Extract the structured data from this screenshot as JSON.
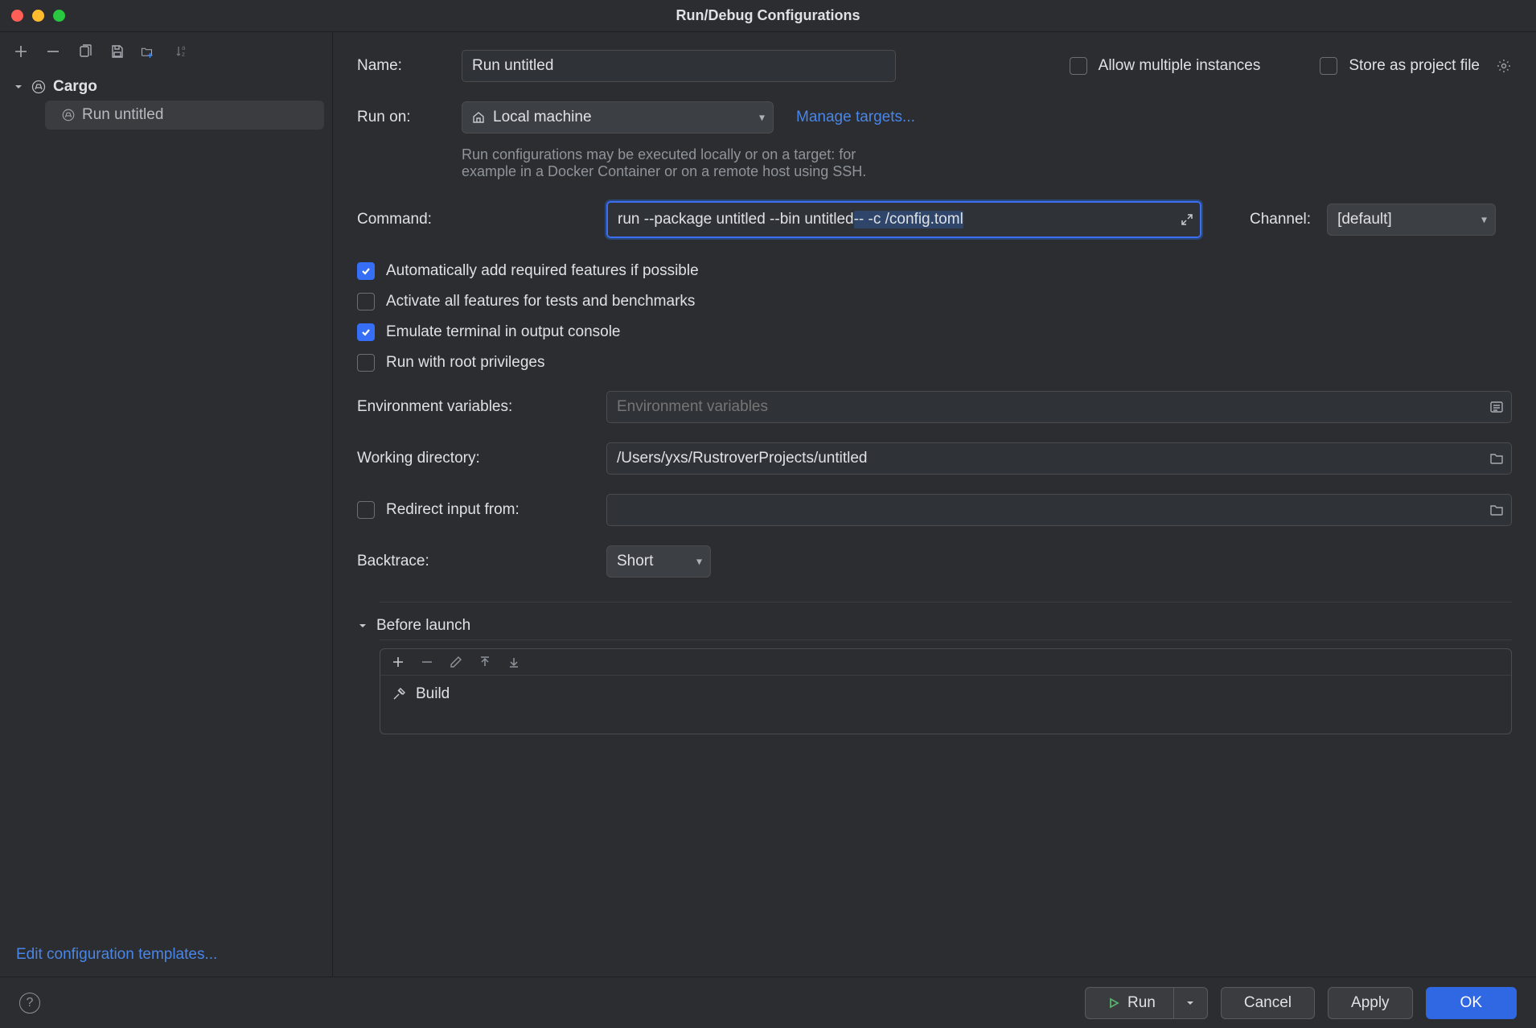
{
  "window": {
    "title": "Run/Debug Configurations"
  },
  "sidebar": {
    "group": "Cargo",
    "item": "Run untitled",
    "footer_link": "Edit configuration templates..."
  },
  "fields": {
    "name_label": "Name:",
    "name_value": "Run untitled",
    "allow_multiple": "Allow multiple instances",
    "store_project": "Store as project file",
    "run_on_label": "Run on:",
    "run_on_value": "Local machine",
    "manage_targets": "Manage targets...",
    "run_on_help1": "Run configurations may be executed locally or on a target: for",
    "run_on_help2": "example in a Docker Container or on a remote host using SSH.",
    "command_label": "Command:",
    "command_value_pre": "run --package untitled --bin untitled",
    "command_value_sel": " -- -c /config.toml",
    "channel_label": "Channel:",
    "channel_value": "[default]",
    "cb_auto_features": "Automatically add required features if possible",
    "cb_activate_all": "Activate all features for tests and benchmarks",
    "cb_emulate_term": "Emulate terminal in output console",
    "cb_root": "Run with root privileges",
    "env_label": "Environment variables:",
    "env_placeholder": "Environment variables",
    "wd_label": "Working directory:",
    "wd_value": "/Users/yxs/RustroverProjects/untitled",
    "redirect_label": "Redirect input from:",
    "backtrace_label": "Backtrace:",
    "backtrace_value": "Short",
    "before_launch": "Before launch",
    "build_task": "Build"
  },
  "footer": {
    "run": "Run",
    "cancel": "Cancel",
    "apply": "Apply",
    "ok": "OK"
  },
  "checkboxes": {
    "allow_multiple": false,
    "store_project": false,
    "auto_features": true,
    "activate_all": false,
    "emulate_term": true,
    "root": false,
    "redirect": false
  },
  "colors": {
    "accent": "#366ef5",
    "bg": "#2b2d30",
    "link": "#4a86e8",
    "traffic": {
      "close": "#ff5f57",
      "min": "#febc2e",
      "max": "#28c840"
    }
  }
}
